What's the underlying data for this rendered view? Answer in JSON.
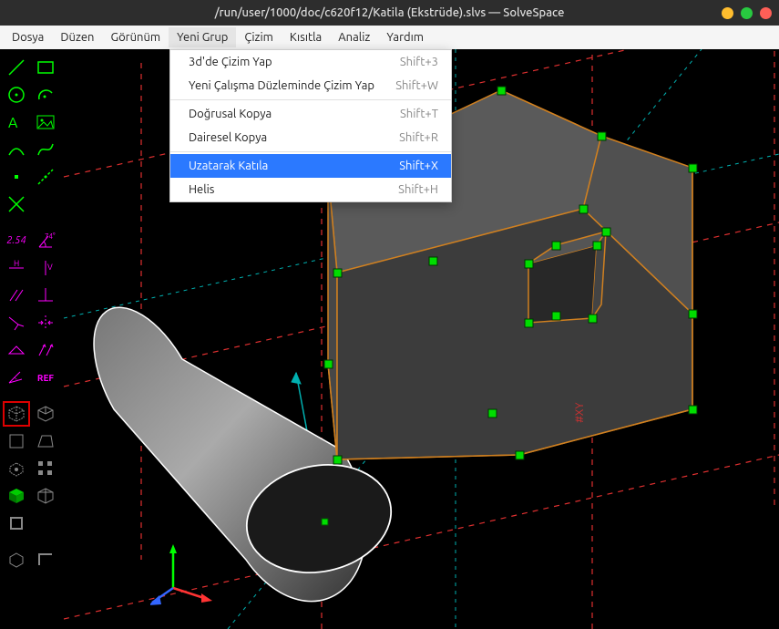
{
  "window": {
    "title": "/run/user/1000/doc/c620f12/Katila (Ekstrüde).slvs — SolveSpace"
  },
  "menu": {
    "items": [
      "Dosya",
      "Düzen",
      "Görünüm",
      "Yeni Grup",
      "Çizim",
      "Kısıtla",
      "Analiz",
      "Yardım"
    ],
    "open_index": 3
  },
  "dropdown": {
    "items": [
      {
        "label": "3d'de Çizim Yap",
        "shortcut": "Shift+3"
      },
      {
        "label": "Yeni Çalışma Düzleminde Çizim Yap",
        "shortcut": "Shift+W"
      },
      {
        "sep": true
      },
      {
        "label": "Doğrusal Kopya",
        "shortcut": "Shift+T"
      },
      {
        "label": "Dairesel Kopya",
        "shortcut": "Shift+R"
      },
      {
        "sep": true
      },
      {
        "label": "Uzatarak Katıla",
        "shortcut": "Shift+X",
        "highlight": true
      },
      {
        "label": "Helis",
        "shortcut": "Shift+H"
      }
    ]
  },
  "toolbar": {
    "dim_label": "2.54",
    "angle_label": "74°",
    "h_label": "H",
    "v_label": "V",
    "ref_label": "REF",
    "active_tool": "nearest-iso"
  },
  "canvas": {
    "workplane_label": "#XY"
  }
}
